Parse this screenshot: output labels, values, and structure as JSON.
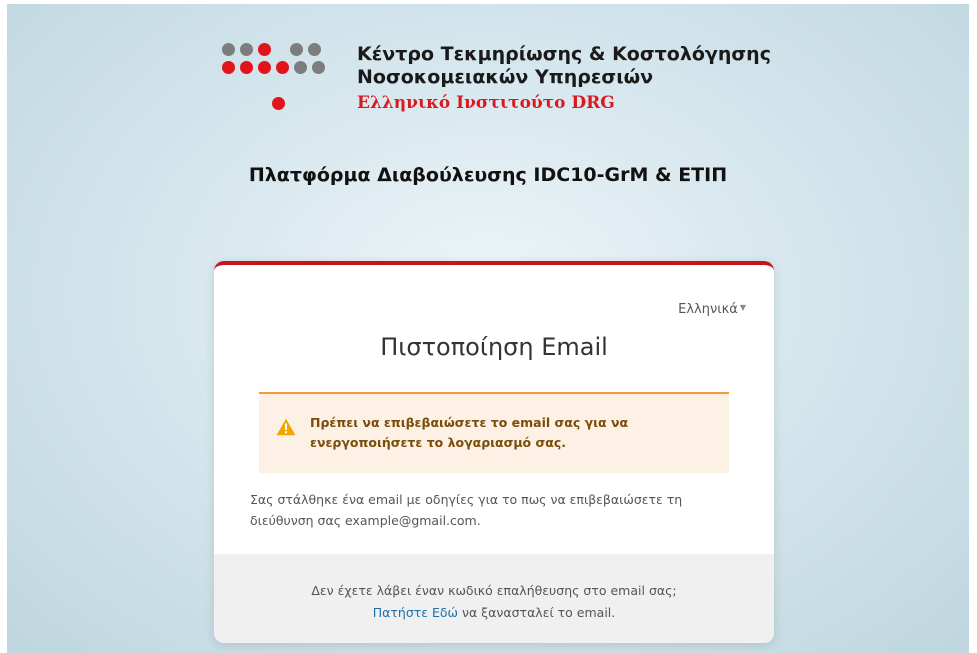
{
  "logo": {
    "line1": "Κέντρο Τεκμηρίωσης & Κοστολόγησης",
    "line2": "Νοσοκομειακών Υπηρεσιών",
    "line3": "Ελληνικό Ινστιτούτο DRG"
  },
  "platform_title": "Πλατφόρμα Διαβούλευσης IDC10-GrM & ΕΤΙΠ",
  "card": {
    "language": "Ελληνικά",
    "title": "Πιστοποίηση Email",
    "alert": {
      "icon": "warning-icon",
      "text": "Πρέπει να επιβεβαιώσετε το email σας για να ενεργοποιήσετε το λογαριασμό σας."
    },
    "info": "Σας στάλθηκε ένα email με οδηγίες για το πως να επιβεβαιώσετε τη διεύθυνση σας example@gmail.com.",
    "footer": {
      "question": "Δεν έχετε λάβει έναν κωδικό επαλήθευσης στο email σας;",
      "link_label": "Πατήστε Εδώ",
      "suffix": " να ξανασταλεί το email."
    }
  },
  "colors": {
    "accent_red": "#c7131a",
    "alert_bg": "#fdf0e4",
    "alert_border": "#ee9c3c",
    "link": "#1f6fa8"
  }
}
